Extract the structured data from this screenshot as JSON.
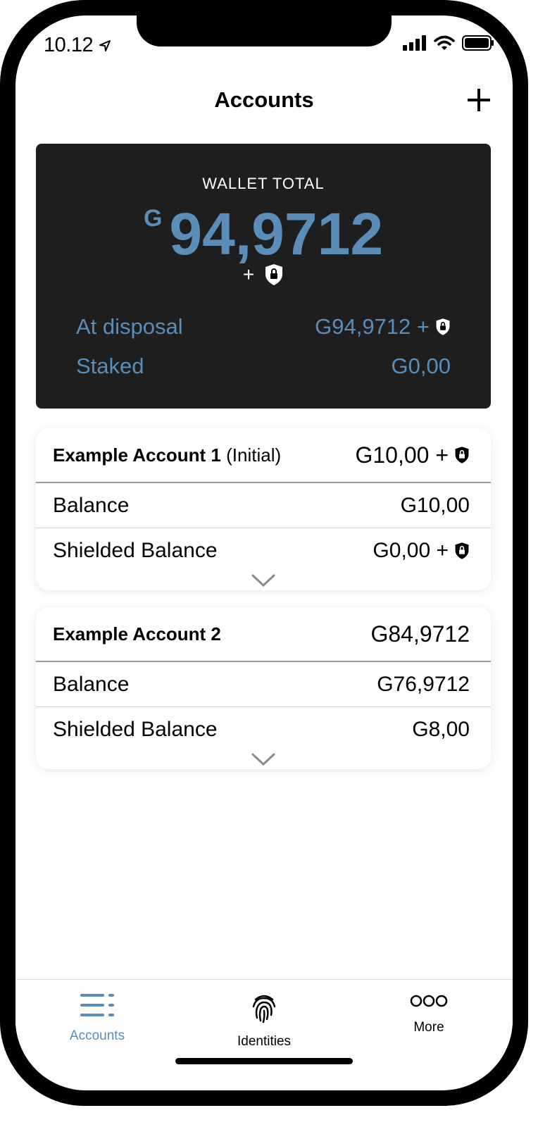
{
  "status": {
    "time": "10.12"
  },
  "header": {
    "title": "Accounts"
  },
  "wallet": {
    "label": "WALLET TOTAL",
    "currency": "G",
    "total": "94,9712",
    "plus": "+",
    "at_disposal_label": "At disposal",
    "at_disposal_value": "G94,9712 +",
    "staked_label": "Staked",
    "staked_value": "G0,00"
  },
  "accounts": [
    {
      "name": "Example Account 1",
      "tag": "(Initial)",
      "total": "G10,00 +",
      "balance_label": "Balance",
      "balance_value": "G10,00",
      "shielded_label": "Shielded Balance",
      "shielded_value": "G0,00 +"
    },
    {
      "name": "Example Account 2",
      "tag": "",
      "total": "G84,9712",
      "balance_label": "Balance",
      "balance_value": "G76,9712",
      "shielded_label": "Shielded Balance",
      "shielded_value": "G8,00"
    }
  ],
  "tabs": [
    {
      "label": "Accounts",
      "icon": "list-icon",
      "active": true
    },
    {
      "label": "Identities",
      "icon": "fingerprint-icon",
      "active": false
    },
    {
      "label": "More",
      "icon": "more-icon",
      "active": false
    }
  ],
  "colors": {
    "accent": "#5a8db8",
    "card_dark": "#1e1e1e"
  }
}
